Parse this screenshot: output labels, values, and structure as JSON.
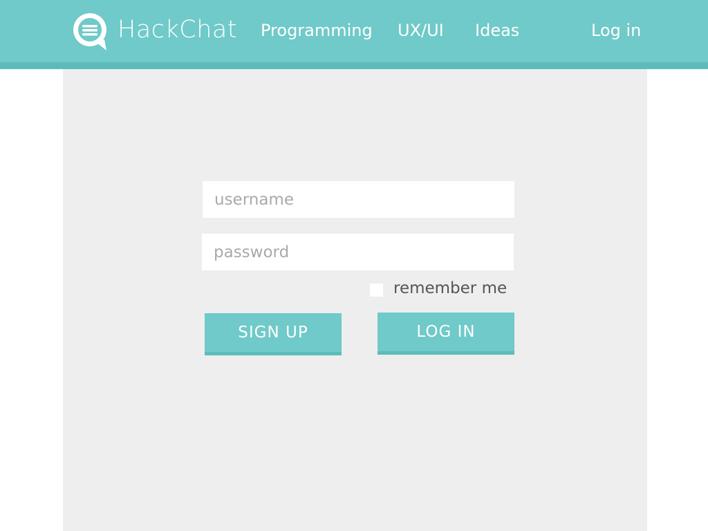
{
  "header": {
    "brand": "HackChat",
    "logo_icon": "chat-bubble-menu-icon",
    "nav": [
      {
        "label": "Programming"
      },
      {
        "label": "UX/UI"
      },
      {
        "label": "Ideas"
      }
    ],
    "login_link": "Log in"
  },
  "form": {
    "username_placeholder": "username",
    "password_placeholder": "password",
    "remember_label": "remember me",
    "remember_checked": false,
    "signup_label": "SIGN UP",
    "login_label": "LOG IN"
  },
  "colors": {
    "accent": "#6fcac9",
    "accent_dark": "#5cbcbb",
    "panel": "#eeeeee",
    "background": "#ffffff"
  }
}
